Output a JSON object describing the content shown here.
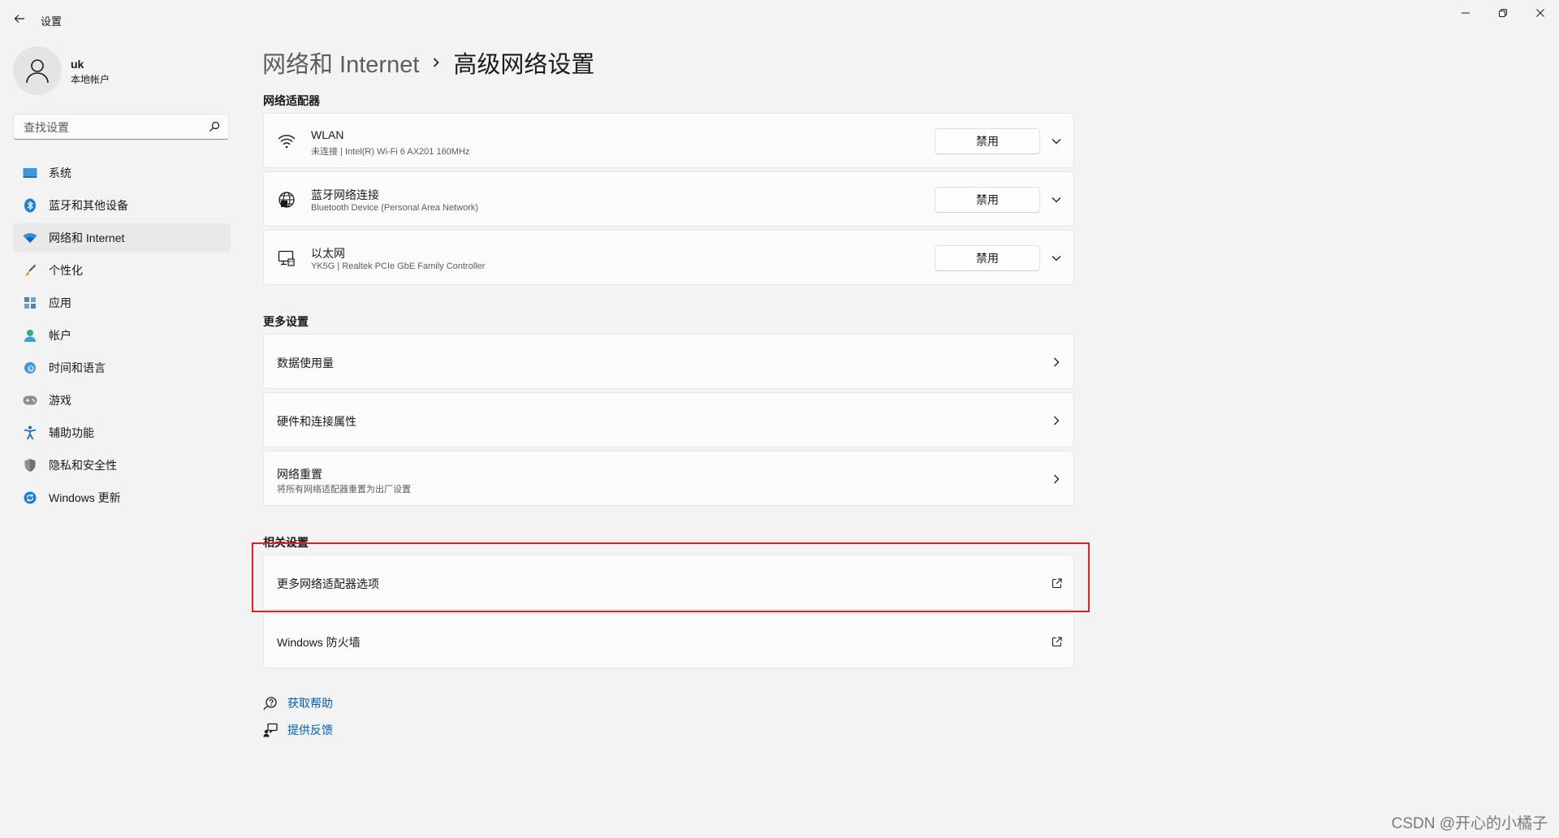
{
  "window": {
    "title": "设置"
  },
  "user": {
    "name": "uk",
    "account_type": "本地帐户"
  },
  "search": {
    "placeholder": "查找设置"
  },
  "sidebar": {
    "items": [
      {
        "label": "系统",
        "icon": "system-icon"
      },
      {
        "label": "蓝牙和其他设备",
        "icon": "bluetooth-icon"
      },
      {
        "label": "网络和 Internet",
        "icon": "network-icon",
        "active": true
      },
      {
        "label": "个性化",
        "icon": "brush-icon"
      },
      {
        "label": "应用",
        "icon": "apps-icon"
      },
      {
        "label": "帐户",
        "icon": "account-icon"
      },
      {
        "label": "时间和语言",
        "icon": "time-language-icon"
      },
      {
        "label": "游戏",
        "icon": "gaming-icon"
      },
      {
        "label": "辅助功能",
        "icon": "accessibility-icon"
      },
      {
        "label": "隐私和安全性",
        "icon": "shield-icon"
      },
      {
        "label": "Windows 更新",
        "icon": "update-icon"
      }
    ]
  },
  "breadcrumb": {
    "parent": "网络和 Internet",
    "current": "高级网络设置"
  },
  "adapters": {
    "heading": "网络适配器",
    "items": [
      {
        "name": "WLAN",
        "detail": "未连接 | Intel(R) Wi-Fi 6 AX201 160MHz",
        "button": "禁用",
        "icon": "wifi-icon"
      },
      {
        "name": "蓝牙网络连接",
        "detail": "Bluetooth Device (Personal Area Network)",
        "button": "禁用",
        "icon": "globe-icon"
      },
      {
        "name": "以太网",
        "detail": "YK5G | Realtek PCIe GbE Family Controller",
        "button": "禁用",
        "icon": "ethernet-icon"
      }
    ]
  },
  "more_settings": {
    "heading": "更多设置",
    "items": [
      {
        "title": "数据使用量",
        "subtitle": ""
      },
      {
        "title": "硬件和连接属性",
        "subtitle": ""
      },
      {
        "title": "网络重置",
        "subtitle": "将所有网络适配器重置为出厂设置"
      }
    ]
  },
  "related_settings": {
    "heading": "相关设置",
    "items": [
      {
        "title": "更多网络适配器选项"
      },
      {
        "title": "Windows 防火墙"
      }
    ]
  },
  "help": {
    "get_help": "获取帮助",
    "feedback": "提供反馈"
  },
  "watermark": "CSDN @开心的小橘子",
  "colors": {
    "accent": "#0067c0",
    "link": "#005fb8",
    "highlight_border": "#e02020",
    "background": "#f3f3f3"
  }
}
